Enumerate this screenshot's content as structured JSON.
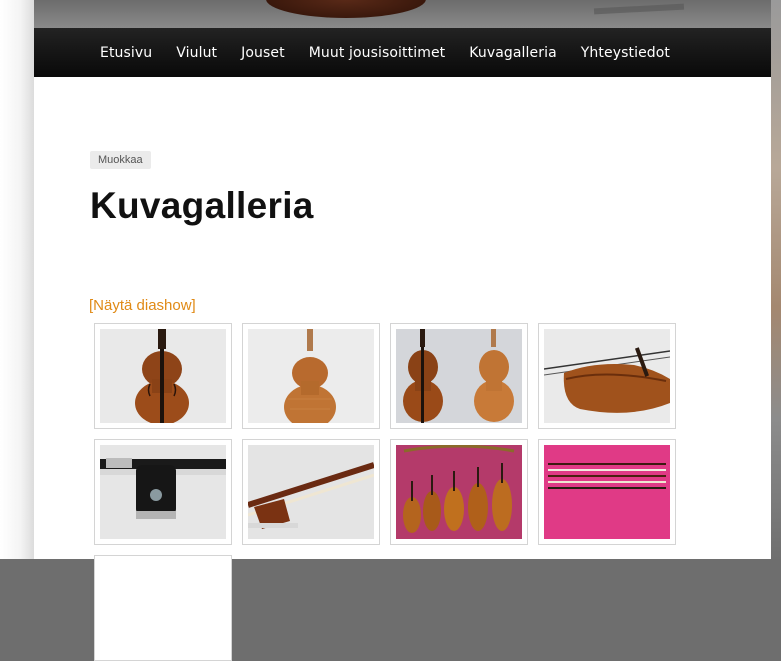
{
  "nav": {
    "items": [
      "Etusivu",
      "Viulut",
      "Jouset",
      "Muut jousisoittimet",
      "Kuvagalleria",
      "Yhteystiedot"
    ]
  },
  "edit_label": "Muokkaa",
  "page_title": "Kuvagalleria",
  "slideshow_link": "[Näytä diashow]",
  "gallery": {
    "thumbnails": [
      {
        "subject": "violin-front"
      },
      {
        "subject": "violin-back"
      },
      {
        "subject": "violin-front-and-back"
      },
      {
        "subject": "violin-side"
      },
      {
        "subject": "bow-frog-dark"
      },
      {
        "subject": "bow-frog-light"
      },
      {
        "subject": "violins-row-on-pink"
      },
      {
        "subject": "bows-on-pink"
      },
      {
        "subject": "partial-thumbnail"
      }
    ]
  },
  "colors": {
    "link_orange": "#e08a16",
    "nav_bg": "#111111",
    "wood": "#a0521c"
  }
}
